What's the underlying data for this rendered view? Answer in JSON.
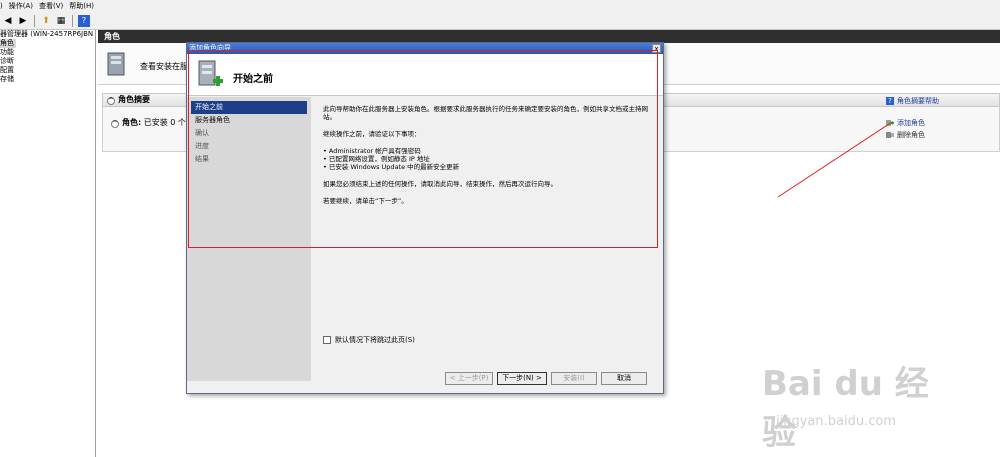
{
  "menubar": {
    "items": [
      ")",
      "操作(A)",
      "查看(V)",
      "帮助(H)"
    ]
  },
  "tree": {
    "root": "器管理器 (WIN-2457RP6JBN",
    "items": [
      "角色",
      "功能",
      "诊断",
      "配置",
      "存储"
    ]
  },
  "right": {
    "header": "角色",
    "banner_text": "查看安装在服",
    "summary_title": "角色摘要",
    "installed_label": "角色:",
    "installed_value": "已安装 0 个",
    "help_link": "角色摘要帮助",
    "actions": {
      "add": "添加角色",
      "remove": "删除角色"
    }
  },
  "dialog": {
    "title": "添加角色向导",
    "close": "x",
    "header_title": "开始之前",
    "nav": [
      "开始之前",
      "服务器角色",
      "确认",
      "进度",
      "结果"
    ],
    "content": {
      "p1": "此向导帮助你在此服务器上安装角色。根据要求此服务器执行的任务来确定要安装的角色，例如共享文档或主持网站。",
      "p2": "继续操作之前，请验证以下事项：",
      "bullets": [
        "Administrator 帐户具有强密码",
        "已配置网络设置，例如静态 IP 地址",
        "已安装 Windows Update 中的最新安全更新"
      ],
      "p3": "如果您必须结束上述的任何操作，请取消此向导，结束操作，然后再次运行向导。",
      "p4": "若要继续，请单击“下一步”。"
    },
    "skip_label": "默认情况下将跳过此页(S)",
    "buttons": {
      "back": "< 上一步(P)",
      "next": "下一步(N) >",
      "install": "安装(I)",
      "cancel": "取消"
    }
  },
  "watermark": {
    "brand": "Bai du 经验",
    "url": "jingyan.baidu.com"
  },
  "colors": {
    "annotation": "#e21c24",
    "title_bar": "#2855b8",
    "nav_active": "#1d3f8a"
  }
}
